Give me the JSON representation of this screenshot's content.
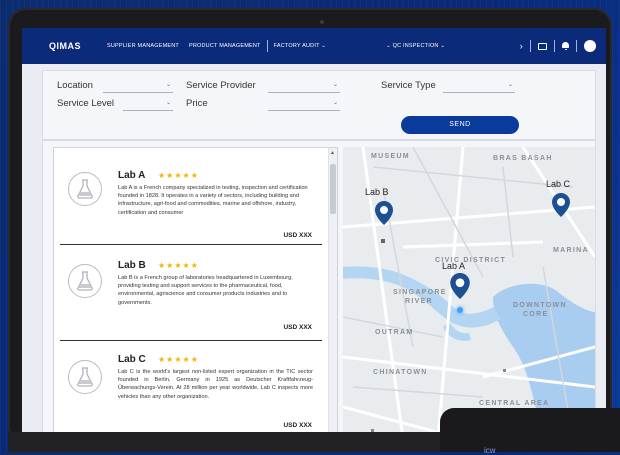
{
  "topbar": {
    "logo": "QIMAS",
    "nav": [
      "SUPPLIER MANAGEMENT",
      "PRODUCT MANAGEMENT",
      "FACTORY AUDIT ⌄",
      "⌄  QC INSPECTION ⌄"
    ],
    "right_chevron": "›"
  },
  "filters": {
    "location_label": "Location",
    "service_provider_label": "Service Provider",
    "service_type_label": "Service Type",
    "service_level_label": "Service Level",
    "price_label": "Price",
    "send_label": "SEND"
  },
  "labs": [
    {
      "name": "Lab A",
      "stars": "★★★★★",
      "description": "Lab A is a French company specialized in testing, inspection and certification founded in 1828. It operates in a variety of sectors, including building and infrastructure, agri-food and commodities, marine and offshore, industry, certification and consumer",
      "price": "USD XXX"
    },
    {
      "name": "Lab B",
      "stars": "★★★★★",
      "description": "Lab B is a French group of laboratories headquartered in Luxembourg, providing testing and support services to the pharmaceutical, food, environmental, agriscience and consumer products industries and to governments.",
      "price": "USD XXX"
    },
    {
      "name": "Lab C",
      "stars": "★★★★★",
      "description": "Lab C is the world's largest non-listed expert organization in the TIC sector founded in Berlin, Germany in 1925 as Deutscher Kraftfahrzeug-Überwachungs-Verein. At 28 million per year worldwide, Lab C inspects more vehicles than any other organization.",
      "price": "USD XXX"
    }
  ],
  "map": {
    "areas": [
      "MUSEUM",
      "BRAS BASAH",
      "CIVIC DISTRICT",
      "MARINA",
      "SINGAPORE",
      "RIVER",
      "DOWNTOWN",
      "CORE",
      "OUTRAM",
      "CHINATOWN",
      "CENTRAL AREA"
    ],
    "pins": [
      "Lab B",
      "Lab C",
      "Lab A"
    ]
  },
  "colors": {
    "primary": "#0b2a7a",
    "button": "#0b3b9a",
    "star": "#f3b400",
    "pin": "#1d4f93",
    "water": "#a9cdf0"
  },
  "footer": {
    "brand_fragment": "icw"
  }
}
